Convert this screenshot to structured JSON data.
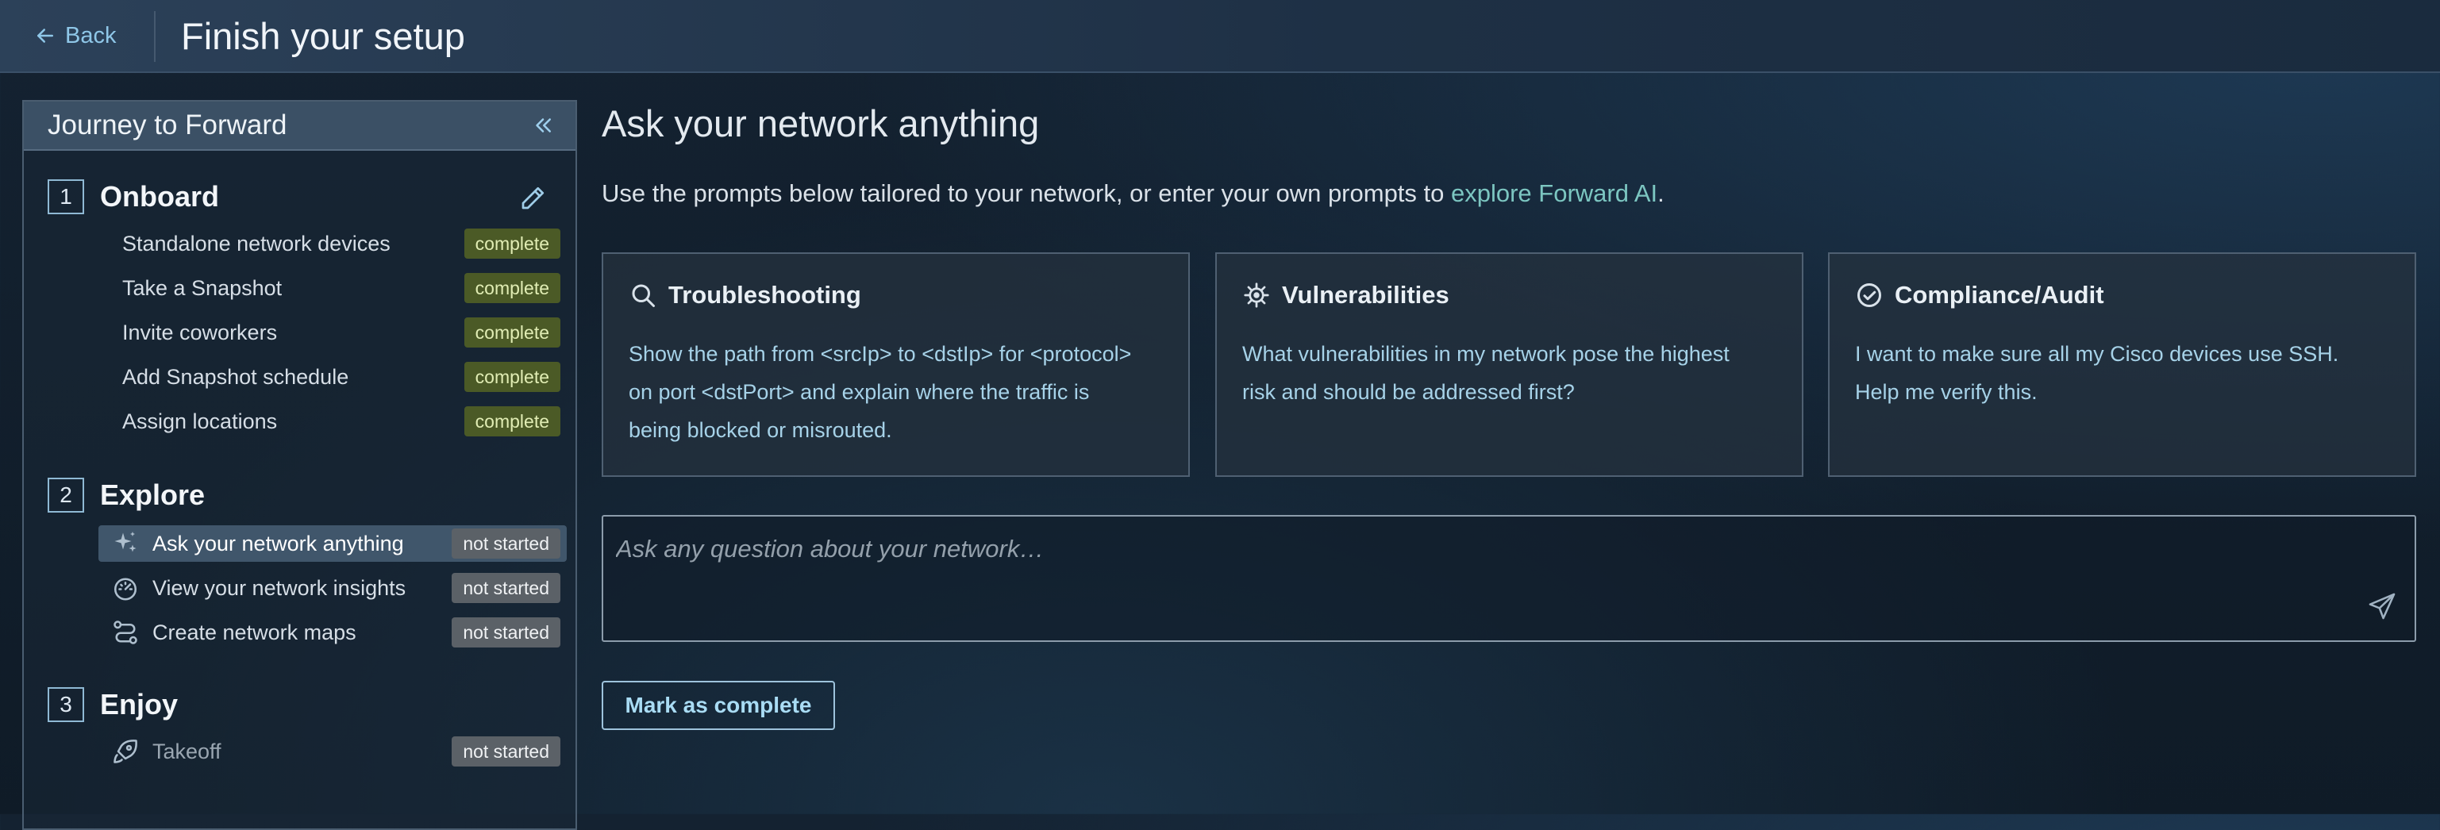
{
  "header": {
    "back_label": "Back",
    "title": "Finish your setup"
  },
  "sidebar": {
    "title": "Journey to Forward",
    "sections": [
      {
        "number": "1",
        "title": "Onboard",
        "tasks": [
          {
            "label": "Standalone network devices",
            "status": "complete"
          },
          {
            "label": "Take a Snapshot",
            "status": "complete"
          },
          {
            "label": "Invite coworkers",
            "status": "complete"
          },
          {
            "label": "Add Snapshot schedule",
            "status": "complete"
          },
          {
            "label": "Assign locations",
            "status": "complete"
          }
        ]
      },
      {
        "number": "2",
        "title": "Explore",
        "tasks": [
          {
            "label": "Ask your network anything",
            "status": "not started",
            "icon": "sparkle-icon",
            "active": true
          },
          {
            "label": "View your network insights",
            "status": "not started",
            "icon": "gauge-icon"
          },
          {
            "label": "Create network maps",
            "status": "not started",
            "icon": "route-icon"
          }
        ]
      },
      {
        "number": "3",
        "title": "Enjoy",
        "tasks": [
          {
            "label": "Takeoff",
            "status": "not started",
            "icon": "rocket-icon"
          }
        ]
      }
    ]
  },
  "main": {
    "title": "Ask your network anything",
    "description_prefix": "Use the prompts below tailored to your network, or enter your own prompts to ",
    "description_link": "explore Forward AI",
    "description_suffix": ".",
    "cards": [
      {
        "icon": "search-icon",
        "title": "Troubleshooting",
        "lines": [
          "Show the path from <srcIp> to <dstIp> for <protocol>",
          "on port <dstPort> and explain where the traffic is",
          "being blocked or misrouted."
        ]
      },
      {
        "icon": "virus-icon",
        "title": "Vulnerabilities",
        "lines": [
          "What vulnerabilities in my network pose the highest",
          "risk and should be addressed first?"
        ]
      },
      {
        "icon": "check-circle-icon",
        "title": "Compliance/Audit",
        "lines": [
          "I want to make sure all my Cisco devices use SSH.",
          "Help me verify this."
        ]
      }
    ],
    "ask_input": {
      "placeholder": "Ask any question about your network…",
      "value": ""
    },
    "mark_complete_label": "Mark as complete"
  },
  "colors": {
    "accent": "#8fc7e8",
    "link": "#7cc6c1",
    "complete_badge": "#4b5a26",
    "not_started_badge": "#5b6167"
  }
}
